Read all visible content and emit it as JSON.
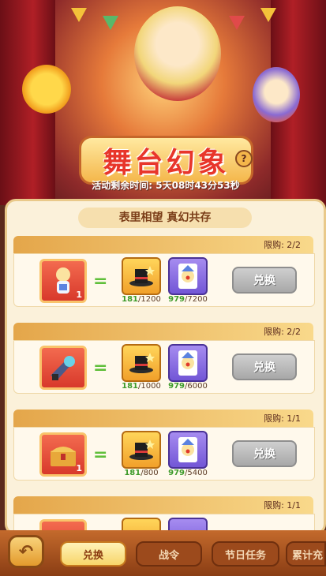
{
  "header": {
    "title": "舞台幻象",
    "help_glyph": "?",
    "timer_label": "活动剩余时间:",
    "timer_value": "5天08时43分53秒"
  },
  "panel": {
    "subtitle": "表里相望 真幻共存"
  },
  "cards": [
    {
      "limit": "限购: 2/2",
      "hero_quality": "1",
      "gold_have": "181",
      "gold_need": "/1200",
      "purple_have": "979",
      "purple_need": "/7200",
      "button": "兑换"
    },
    {
      "limit": "限购: 2/2",
      "hero_quality": "",
      "gold_have": "181",
      "gold_need": "/1000",
      "purple_have": "979",
      "purple_need": "/6000",
      "button": "兑换"
    },
    {
      "limit": "限购: 1/1",
      "hero_quality": "1",
      "gold_have": "181",
      "gold_need": "/800",
      "purple_have": "979",
      "purple_need": "/5400",
      "button": "兑换"
    },
    {
      "limit": "限购: 1/1"
    }
  ],
  "tabs": [
    {
      "label": "兑换",
      "active": true
    },
    {
      "label": "战令",
      "active": false
    },
    {
      "label": "节日任务",
      "active": false
    },
    {
      "label": "累计充",
      "active": false
    }
  ],
  "colors": {
    "accent_red": "#e8362b",
    "have_green": "#3d9a2a",
    "button_gray": "#a8a8a8"
  }
}
